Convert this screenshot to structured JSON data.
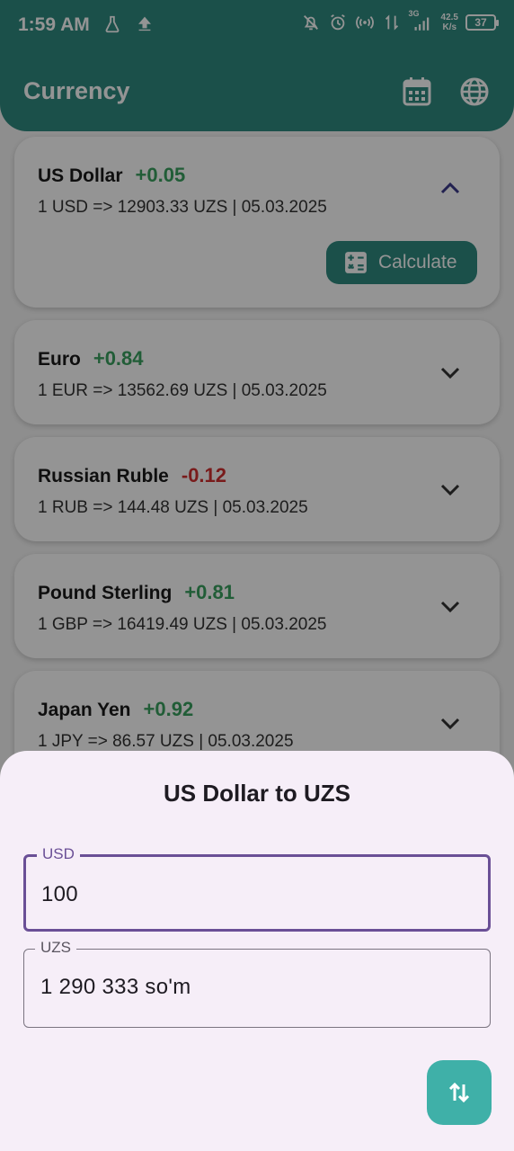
{
  "status": {
    "time": "1:59 AM",
    "network": "3G",
    "speed_value": "42.5",
    "speed_unit": "K/s",
    "battery": "37"
  },
  "appbar": {
    "title": "Currency",
    "calendar_icon": "calendar-icon",
    "globe_icon": "globe-icon"
  },
  "currencies": [
    {
      "name": "US Dollar",
      "diff": "+0.05",
      "rate": "1 USD => 12903.33 UZS |  05.03.2025",
      "expanded": true,
      "calc_label": "Calculate"
    },
    {
      "name": "Euro",
      "diff": "+0.84",
      "rate": "1 EUR => 13562.69 UZS |  05.03.2025"
    },
    {
      "name": "Russian Ruble",
      "diff": "-0.12",
      "rate": "1 RUB => 144.48 UZS |  05.03.2025"
    },
    {
      "name": "Pound Sterling",
      "diff": "+0.81",
      "rate": "1 GBP => 16419.49 UZS |  05.03.2025"
    },
    {
      "name": "Japan Yen",
      "diff": "+0.92",
      "rate": "1 JPY => 86.57 UZS |  05.03.2025"
    }
  ],
  "sheet": {
    "title": "US Dollar to UZS",
    "from_label": "USD",
    "from_value": "100",
    "to_label": "UZS",
    "to_value": "1 290 333 so'm",
    "swap_icon": "swap-vertical-icon"
  },
  "colors": {
    "primary": "#2f8a80",
    "positive": "#3aa060",
    "negative": "#d03030",
    "focus": "#6a4f96",
    "sheet_bg": "#f6eef8",
    "fab": "#3fb0a8"
  }
}
